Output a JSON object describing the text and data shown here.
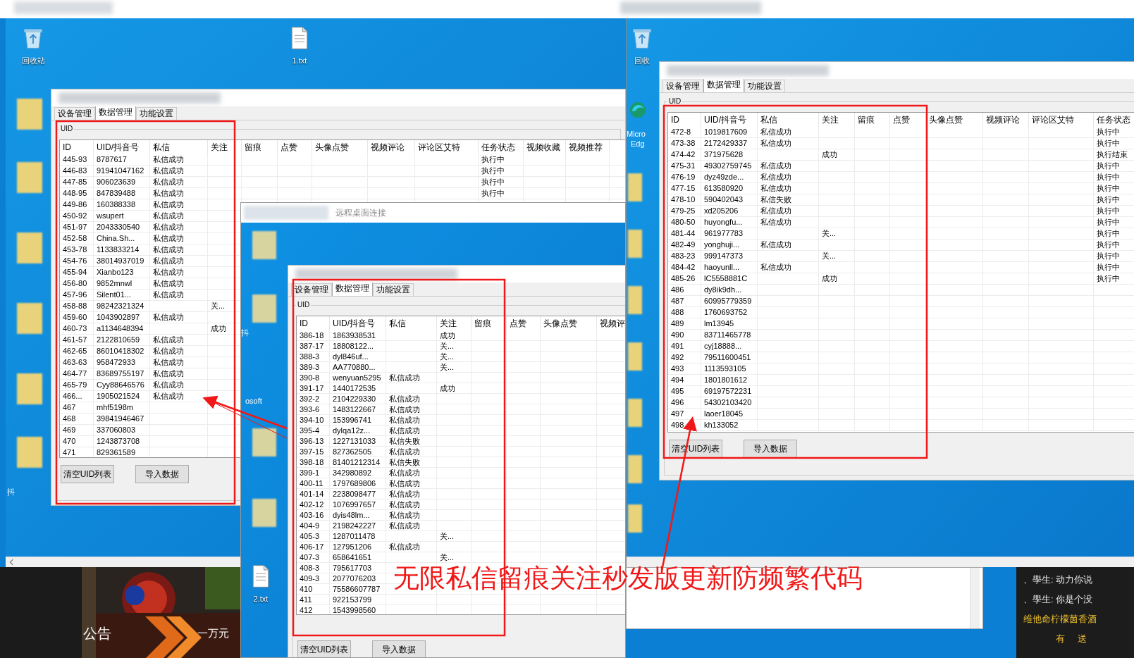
{
  "left_desktop": {
    "icons": [
      {
        "label": "回收站"
      },
      {
        "label": "1.txt"
      }
    ],
    "edge_labels": [
      "抖"
    ]
  },
  "windows": [
    {
      "tabs": [
        {
          "label": "设备管理",
          "selected": false
        },
        {
          "label": "数据管理",
          "selected": true
        },
        {
          "label": "功能设置",
          "selected": false
        }
      ],
      "group": "UID",
      "columns": [
        "ID",
        "UID/抖音号",
        "私信",
        "关注",
        "留痕",
        "点赞",
        "头像点赞",
        "视频评论",
        "评论区艾特",
        "任务状态",
        "视频收藏",
        "视频推荐"
      ],
      "rows": [
        {
          "id": "445-93",
          "uid": "8787617",
          "message": "私信成功",
          "task_status": "执行中"
        },
        {
          "id": "446-83",
          "uid": "91941047162",
          "message": "私信成功",
          "task_status": "执行中"
        },
        {
          "id": "447-85",
          "uid": "906023639",
          "message": "私信成功",
          "task_status": "执行中"
        },
        {
          "id": "448-95",
          "uid": "847839488",
          "message": "私信成功",
          "task_status": "执行中"
        },
        {
          "id": "449-86",
          "uid": "160388338",
          "message": "私信成功"
        },
        {
          "id": "450-92",
          "uid": "wsupert",
          "message": "私信成功"
        },
        {
          "id": "451-97",
          "uid": "2043330540",
          "message": "私信成功"
        },
        {
          "id": "452-58",
          "uid": "China.Sh...",
          "message": "私信成功"
        },
        {
          "id": "453-78",
          "uid": "1133833214",
          "message": "私信成功"
        },
        {
          "id": "454-76",
          "uid": "38014937019",
          "message": "私信成功"
        },
        {
          "id": "455-94",
          "uid": "Xianbo123",
          "message": "私信成功"
        },
        {
          "id": "456-80",
          "uid": "9852mnwl",
          "message": "私信成功"
        },
        {
          "id": "457-96",
          "uid": "Silent01...",
          "message": "私信成功"
        },
        {
          "id": "458-88",
          "uid": "98242321324",
          "follow": "关..."
        },
        {
          "id": "459-60",
          "uid": "1043902897",
          "message": "私信成功"
        },
        {
          "id": "460-73",
          "uid": "a1134648394",
          "follow": "成功"
        },
        {
          "id": "461-57",
          "uid": "2122810659",
          "message": "私信成功"
        },
        {
          "id": "462-65",
          "uid": "86010418302",
          "message": "私信成功"
        },
        {
          "id": "463-63",
          "uid": "958472933",
          "message": "私信成功"
        },
        {
          "id": "464-77",
          "uid": "83689755197",
          "message": "私信成功"
        },
        {
          "id": "465-79",
          "uid": "Cyy88646576",
          "message": "私信成功"
        },
        {
          "id": "466...",
          "uid": "1905021524",
          "message": "私信成功"
        },
        {
          "id": "467",
          "uid": "mhf5198m"
        },
        {
          "id": "468",
          "uid": "39841946467"
        },
        {
          "id": "469",
          "uid": "337060803"
        },
        {
          "id": "470",
          "uid": "1243873708"
        },
        {
          "id": "471",
          "uid": "829361589"
        }
      ],
      "buttons": [
        "清空UID列表",
        "导入数据"
      ]
    },
    {
      "tabs": [
        {
          "label": "设备管理",
          "selected": false
        },
        {
          "label": "数据管理",
          "selected": true
        },
        {
          "label": "功能设置",
          "selected": false
        }
      ],
      "group": "UID",
      "columns": [
        "ID",
        "UID/抖音号",
        "私信",
        "关注",
        "留痕",
        "点赞",
        "头像点赞",
        "视频评"
      ],
      "rows": [
        {
          "id": "386-18",
          "uid": "1863938531",
          "follow": "成功"
        },
        {
          "id": "387-17",
          "uid": "18808122...",
          "follow": "关..."
        },
        {
          "id": "388-3",
          "uid": "dyl846uf...",
          "follow": "关..."
        },
        {
          "id": "389-3",
          "uid": "AA770880...",
          "follow": "关..."
        },
        {
          "id": "390-8",
          "uid": "wenyuan5295",
          "message": "私信成功"
        },
        {
          "id": "391-17",
          "uid": "1440172535",
          "follow": "成功"
        },
        {
          "id": "392-2",
          "uid": "2104229330",
          "message": "私信成功"
        },
        {
          "id": "393-6",
          "uid": "1483122667",
          "message": "私信成功"
        },
        {
          "id": "394-10",
          "uid": "153996741",
          "message": "私信成功"
        },
        {
          "id": "395-4",
          "uid": "dylqa12z...",
          "message": "私信成功"
        },
        {
          "id": "396-13",
          "uid": "1227131033",
          "message": "私信失败"
        },
        {
          "id": "397-15",
          "uid": "827362505",
          "message": "私信成功"
        },
        {
          "id": "398-18",
          "uid": "81401212314",
          "message": "私信失败"
        },
        {
          "id": "399-1",
          "uid": "342980892",
          "message": "私信成功"
        },
        {
          "id": "400-11",
          "uid": "1797689806",
          "message": "私信成功"
        },
        {
          "id": "401-14",
          "uid": "2238098477",
          "message": "私信成功"
        },
        {
          "id": "402-12",
          "uid": "1076997657",
          "message": "私信成功"
        },
        {
          "id": "403-16",
          "uid": "dyis48lm...",
          "message": "私信成功"
        },
        {
          "id": "404-9",
          "uid": "2198242227",
          "message": "私信成功"
        },
        {
          "id": "405-3",
          "uid": "1287011478",
          "follow": "关..."
        },
        {
          "id": "406-17",
          "uid": "127951206",
          "message": "私信成功"
        },
        {
          "id": "407-3",
          "uid": "658641651",
          "follow": "关..."
        },
        {
          "id": "408-3",
          "uid": "795617703"
        },
        {
          "id": "409-3",
          "uid": "2077076203"
        },
        {
          "id": "410",
          "uid": "75586607787"
        },
        {
          "id": "411",
          "uid": "922153799"
        },
        {
          "id": "412",
          "uid": "1543998560"
        }
      ],
      "buttons": [
        "清空UID列表",
        "导入数据"
      ]
    },
    {
      "tabs": [
        {
          "label": "设备管理",
          "selected": false
        },
        {
          "label": "数据管理",
          "selected": true
        },
        {
          "label": "功能设置",
          "selected": false
        }
      ],
      "group": "UID",
      "columns": [
        "ID",
        "UID/抖音号",
        "私信",
        "关注",
        "留痕",
        "点赞",
        "头像点赞",
        "视频评论",
        "评论区艾特",
        "任务状态"
      ],
      "rows": [
        {
          "id": "472-8",
          "uid": "1019817609",
          "message": "私信成功",
          "task_status": "执行中"
        },
        {
          "id": "473-38",
          "uid": "2172429337",
          "message": "私信成功",
          "task_status": "执行中"
        },
        {
          "id": "474-42",
          "uid": "371975628",
          "follow": "成功",
          "task_status": "执行结束"
        },
        {
          "id": "475-31",
          "uid": "49302759745",
          "message": "私信成功",
          "task_status": "执行中"
        },
        {
          "id": "476-19",
          "uid": "dyz49zde...",
          "message": "私信成功",
          "task_status": "执行中"
        },
        {
          "id": "477-15",
          "uid": "613580920",
          "message": "私信成功",
          "task_status": "执行中"
        },
        {
          "id": "478-10",
          "uid": "590402043",
          "message": "私信失败",
          "task_status": "执行中"
        },
        {
          "id": "479-25",
          "uid": "xd205206",
          "message": "私信成功",
          "task_status": "执行中"
        },
        {
          "id": "480-50",
          "uid": "huyongfu...",
          "message": "私信成功",
          "task_status": "执行中"
        },
        {
          "id": "481-44",
          "uid": "961977783",
          "follow": "关...",
          "task_status": "执行中"
        },
        {
          "id": "482-49",
          "uid": "yonghuji...",
          "message": "私信成功",
          "task_status": "执行中"
        },
        {
          "id": "483-23",
          "uid": "999147373",
          "follow": "关...",
          "task_status": "执行中"
        },
        {
          "id": "484-42",
          "uid": "haoyunll...",
          "message": "私信成功",
          "task_status": "执行中"
        },
        {
          "id": "485-26",
          "uid": "lC5558881C",
          "follow": "成功",
          "task_status": "执行中"
        },
        {
          "id": "486",
          "uid": "dy8ik9dh..."
        },
        {
          "id": "487",
          "uid": "60995779359"
        },
        {
          "id": "488",
          "uid": "1760693752"
        },
        {
          "id": "489",
          "uid": "lm13945"
        },
        {
          "id": "490",
          "uid": "83711465778"
        },
        {
          "id": "491",
          "uid": "cyj18888..."
        },
        {
          "id": "492",
          "uid": "79511600451"
        },
        {
          "id": "493",
          "uid": "1113593105"
        },
        {
          "id": "494",
          "uid": "1801801612"
        },
        {
          "id": "495",
          "uid": "69197572231"
        },
        {
          "id": "496",
          "uid": "54302103420"
        },
        {
          "id": "497",
          "uid": "laoer18045"
        },
        {
          "id": "498",
          "uid": "kh133052"
        }
      ],
      "buttons": [
        "清空UID列表",
        "导入数据"
      ]
    }
  ],
  "remote_desktop": {
    "title": "远程桌面连接",
    "icon_labels": [
      "抖",
      "osoft",
      "2.txt"
    ]
  },
  "right_desktop": {
    "icon_labels": [
      "回收",
      "Micro",
      "Edg"
    ]
  },
  "banner": {
    "label": "公告",
    "text": "一万元"
  },
  "chat": {
    "lines": [
      "、學生: 动力你说",
      "、學生: 你是个没",
      "维他命柠檬茵香酒"
    ],
    "actions": [
      "有",
      "送"
    ]
  },
  "caption": "无限私信留痕关注秒发版更新防频繁代码"
}
